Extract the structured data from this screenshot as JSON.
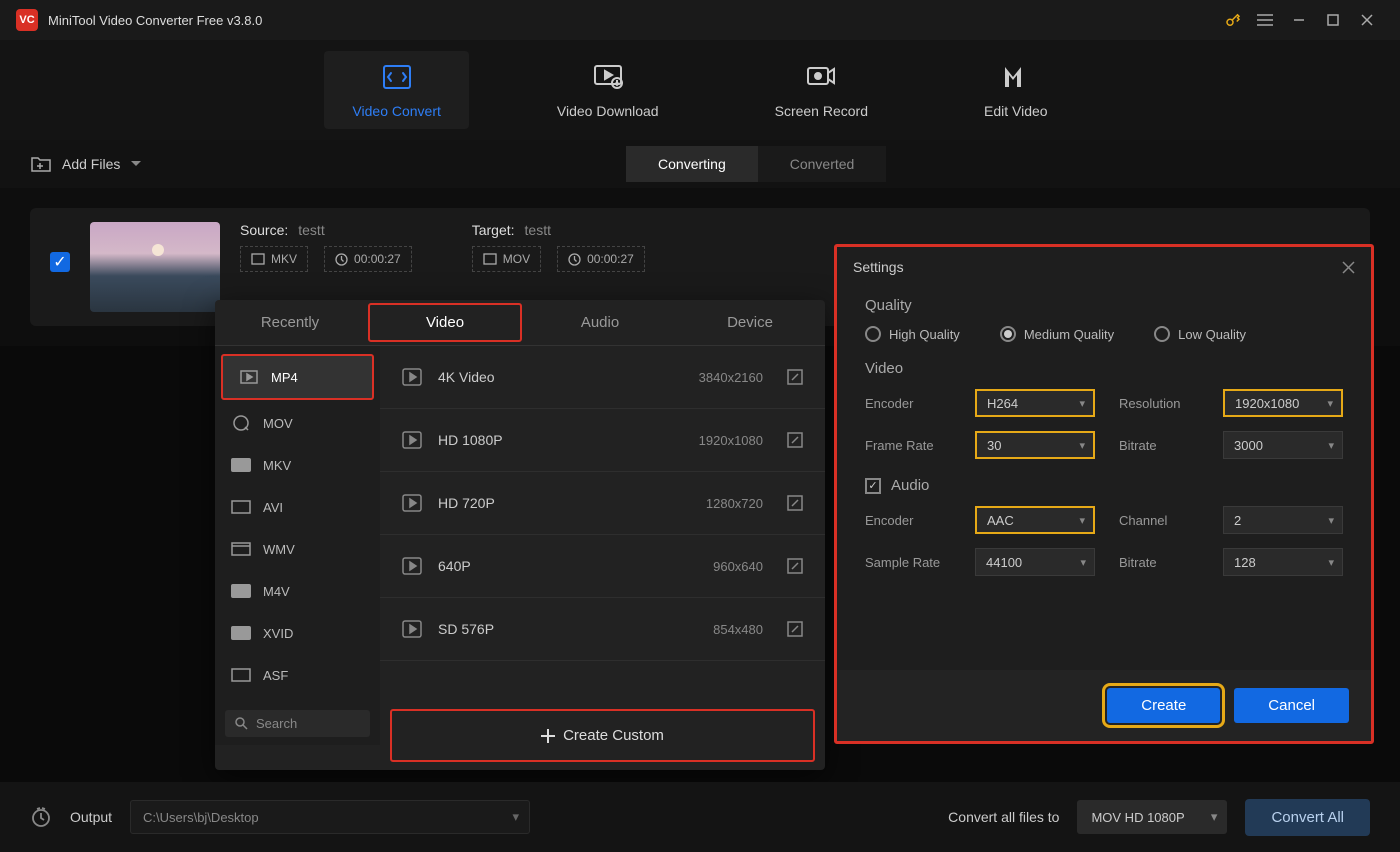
{
  "titlebar": {
    "title": "MiniTool Video Converter Free v3.8.0"
  },
  "main_tabs": {
    "video_convert": "Video Convert",
    "video_download": "Video Download",
    "screen_record": "Screen Record",
    "edit_video": "Edit Video"
  },
  "toolbar": {
    "add_files": "Add Files"
  },
  "status_tabs": {
    "converting": "Converting",
    "converted": "Converted"
  },
  "file_row": {
    "source_label": "Source:",
    "source_name": "testt",
    "source_format": "MKV",
    "source_duration": "00:00:27",
    "target_label": "Target:",
    "target_name": "testt",
    "target_format": "MOV",
    "target_duration": "00:00:27"
  },
  "format_popup": {
    "tabs": {
      "recently": "Recently",
      "video": "Video",
      "audio": "Audio",
      "device": "Device"
    },
    "formats": [
      "MP4",
      "MOV",
      "MKV",
      "AVI",
      "WMV",
      "M4V",
      "XVID",
      "ASF"
    ],
    "presets": [
      {
        "name": "4K Video",
        "res": "3840x2160"
      },
      {
        "name": "HD 1080P",
        "res": "1920x1080"
      },
      {
        "name": "HD 720P",
        "res": "1280x720"
      },
      {
        "name": "640P",
        "res": "960x640"
      },
      {
        "name": "SD 576P",
        "res": "854x480"
      }
    ],
    "search_placeholder": "Search",
    "create_custom": "Create Custom"
  },
  "settings": {
    "title": "Settings",
    "quality": {
      "label": "Quality",
      "options": {
        "high": "High Quality",
        "medium": "Medium Quality",
        "low": "Low Quality"
      },
      "selected": "medium"
    },
    "video": {
      "label": "Video",
      "encoder_label": "Encoder",
      "encoder": "H264",
      "resolution_label": "Resolution",
      "resolution": "1920x1080",
      "framerate_label": "Frame Rate",
      "framerate": "30",
      "bitrate_label": "Bitrate",
      "bitrate": "3000"
    },
    "audio": {
      "label": "Audio",
      "enabled": true,
      "encoder_label": "Encoder",
      "encoder": "AAC",
      "channel_label": "Channel",
      "channel": "2",
      "samplerate_label": "Sample Rate",
      "samplerate": "44100",
      "bitrate_label": "Bitrate",
      "bitrate": "128"
    },
    "buttons": {
      "create": "Create",
      "cancel": "Cancel"
    }
  },
  "footer": {
    "output_label": "Output",
    "output_path": "C:\\Users\\bj\\Desktop",
    "convert_all_label": "Convert all files to",
    "target_preset": "MOV HD 1080P",
    "convert_all_button": "Convert All"
  }
}
